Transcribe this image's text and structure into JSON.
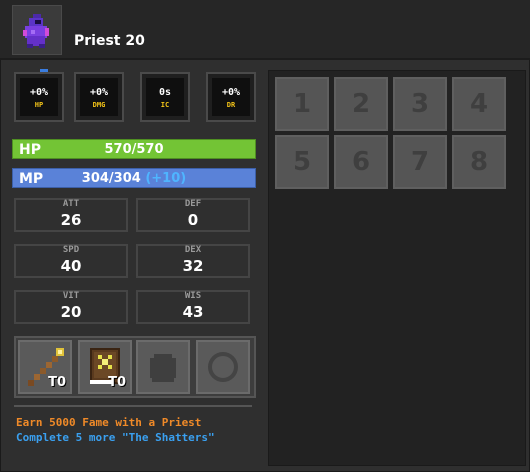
{
  "header": {
    "character_icon": "priest-portrait-icon",
    "title": "Priest 20"
  },
  "boosts": [
    {
      "value": "+0%",
      "label": "HP"
    },
    {
      "value": "+0%",
      "label": "DMG"
    },
    {
      "value": "0s",
      "label": "IC"
    },
    {
      "value": "+0%",
      "label": "DR"
    }
  ],
  "bars": {
    "hp": {
      "name": "HP",
      "value": "570/570",
      "color": "#73c435"
    },
    "mp": {
      "name": "MP",
      "value": "304/304",
      "bonus": "(+10)",
      "color": "#5a82d8"
    }
  },
  "stats": [
    {
      "name": "ATT",
      "value": "26"
    },
    {
      "name": "DEF",
      "value": "0"
    },
    {
      "name": "SPD",
      "value": "40"
    },
    {
      "name": "DEX",
      "value": "32"
    },
    {
      "name": "VIT",
      "value": "20"
    },
    {
      "name": "WIS",
      "value": "43"
    }
  ],
  "equipment": [
    {
      "icon": "staff-icon",
      "tier": "T0"
    },
    {
      "icon": "spellbook-icon",
      "tier": "T0"
    },
    {
      "icon": "armor-slot-icon",
      "tier": ""
    },
    {
      "icon": "ring-slot-icon",
      "tier": ""
    }
  ],
  "quests": {
    "line1": "Earn 5000 Fame with a Priest",
    "line2": "Complete 5 more \"The Shatters\""
  },
  "inventory": {
    "slots": [
      "1",
      "2",
      "3",
      "4",
      "5",
      "6",
      "7",
      "8"
    ]
  },
  "colors": {
    "quest_primary": "#f08a28",
    "quest_secondary": "#3aa0f0",
    "boost_label": "#f5c518"
  }
}
